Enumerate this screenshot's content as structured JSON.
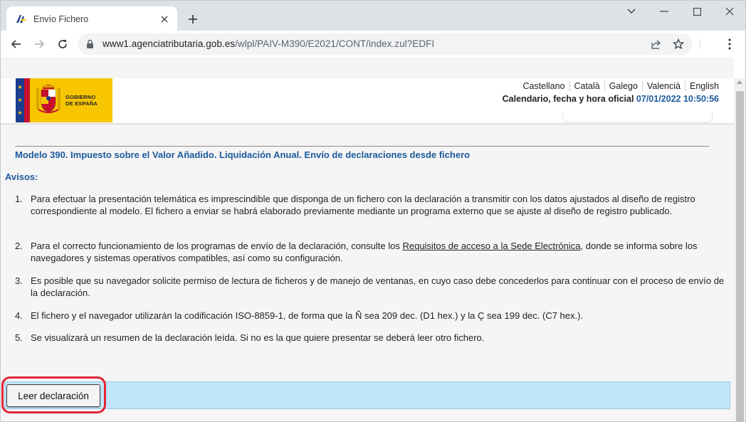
{
  "browser": {
    "tab_title": "Envío Fichero",
    "url_host": "www1.agenciatributaria.gob.es",
    "url_path": "/wlpl/PAIV-M390/E2021/CONT/index.zul?EDFI"
  },
  "header": {
    "logo_line1": "GOBIERNO",
    "logo_line2": "DE ESPAÑA",
    "languages": [
      "Castellano",
      "Català",
      "Galego",
      "Valencià",
      "English"
    ],
    "datetime_label": "Calendario, fecha y hora oficial",
    "datetime_value": "07/01/2022 10:50:56"
  },
  "main": {
    "title": "Modelo 390. Impuesto sobre el Valor Añadido. Liquidación Anual. Envío de declaraciones desde fichero",
    "avisos_label": "Avisos:",
    "notices": [
      {
        "num": "1.",
        "text": "Para efectuar la presentación telemática es imprescindible que disponga de un fichero con la declaración a transmitir con los datos ajustados al diseño de registro correspondiente al modelo. El fichero a enviar se habrá elaborado previamente mediante un programa externo que se ajuste al diseño de registro publicado."
      },
      {
        "num": "2.",
        "text_before": "Para el correcto funcionamiento de los programas de envío de la declaración, consulte los ",
        "link": "Requisitos de acceso a la Sede Electrónica",
        "text_after": ", donde se informa sobre los navegadores y sistemas operativos compatibles, así como su configuración."
      },
      {
        "num": "3.",
        "text": "Es posible que su navegador solicite permiso de lectura de ficheros y de manejo de ventanas, en cuyo caso debe concederlos para continuar con el proceso de envío de la declaración."
      },
      {
        "num": "4.",
        "text": "El fichero y el navegador utilizarán la codificación ISO-8859-1, de forma que la Ñ sea 209 dec. (D1 hex.) y la Ç sea 199 dec. (C7 hex.)."
      },
      {
        "num": "5.",
        "text": "Se visualizará un resumen de la declaración leída. Si no es la que quiere presentar se deberá leer otro fichero."
      }
    ],
    "read_button_label": "Leer declaración"
  },
  "colors": {
    "accent_blue": "#1c5a9c",
    "action_bar": "#bfe6fb",
    "highlight_red": "#e32636",
    "logo_yellow": "#f7c600"
  }
}
